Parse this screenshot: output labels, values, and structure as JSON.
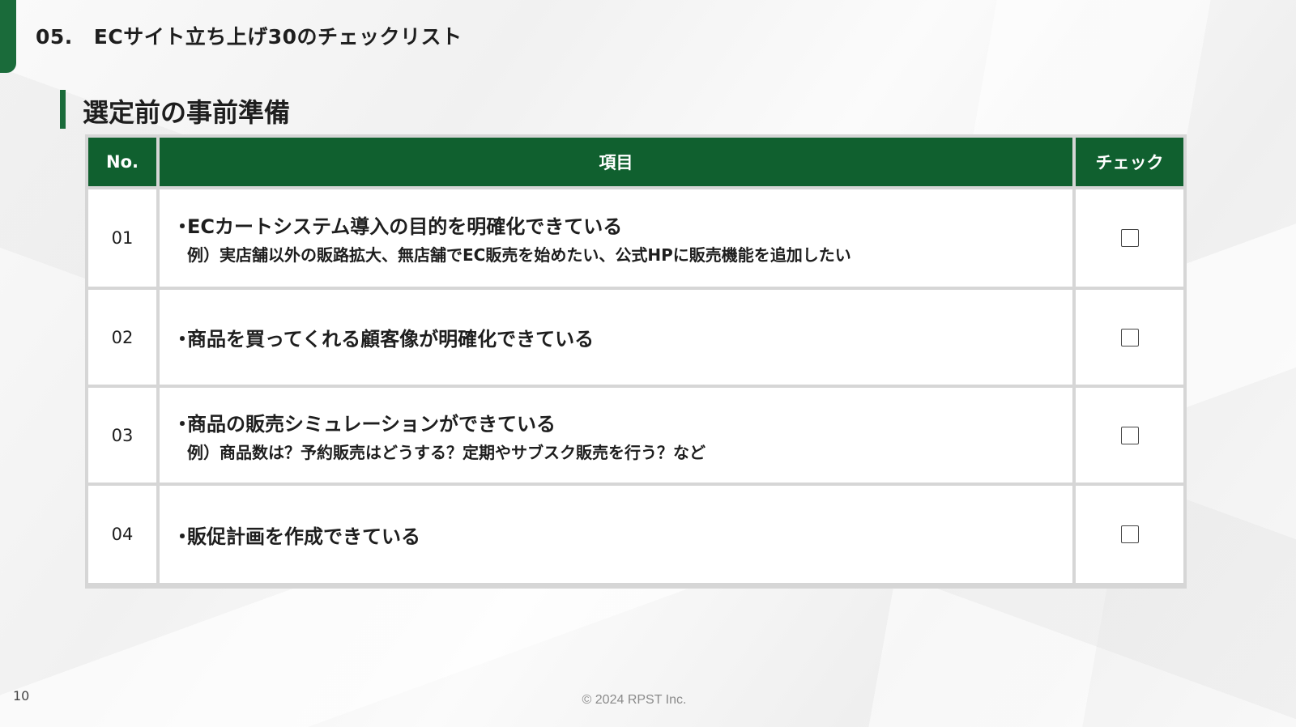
{
  "slide": {
    "number": "05.",
    "title": "ECサイト立ち上げ30のチェックリスト"
  },
  "section": {
    "heading": "選定前の事前準備"
  },
  "table": {
    "headers": [
      "No.",
      "項目",
      "チェック"
    ],
    "rows": [
      {
        "no": "01",
        "main": "ECカートシステム導入の目的を明確化できている",
        "sub": "例）実店舗以外の販路拡大、無店舗でEC販売を始めたい、公式HPに販売機能を追加したい",
        "checked": false
      },
      {
        "no": "02",
        "main": "商品を買ってくれる顧客像が明確化できている",
        "sub": "",
        "checked": false
      },
      {
        "no": "03",
        "main": "商品の販売シミュレーションができている",
        "sub": "例）商品数は？予約販売はどうする？定期やサブスク販売を行う？など",
        "checked": false
      },
      {
        "no": "04",
        "main": "販促計画を作成できている",
        "sub": "",
        "checked": false
      }
    ]
  },
  "bullet": "・",
  "footer": {
    "page": "10",
    "copyright": "© 2024 RPST Inc."
  },
  "colors": {
    "accent_green": "#1a6b3a",
    "header_green": "#10602f",
    "table_border": "#d6d6d6"
  }
}
